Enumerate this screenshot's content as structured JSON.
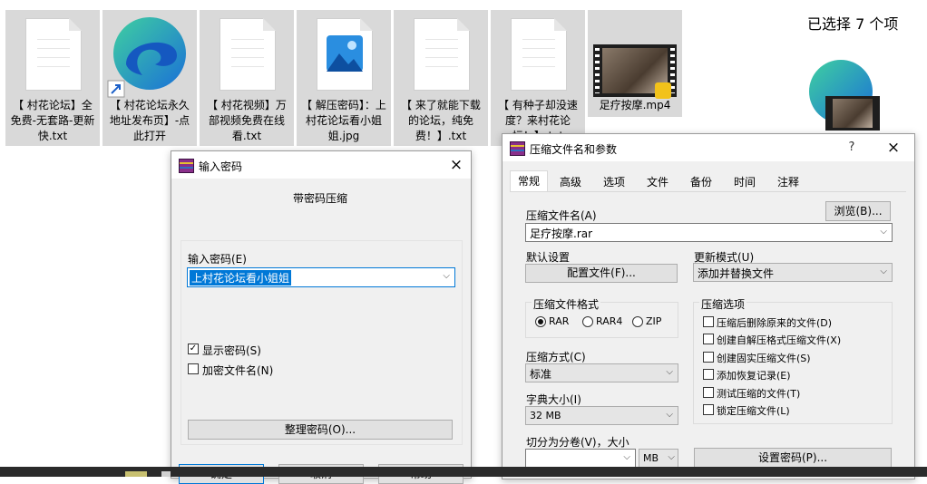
{
  "files": [
    {
      "name": "【 村花论坛】全免费-无套路-更新快.txt",
      "icon": "text-document-icon"
    },
    {
      "name": "【 村花论坛永久地址发布页】-点此打开",
      "icon": "edge-shortcut-icon"
    },
    {
      "name": "【 村花视频】万部视频免费在线看.txt",
      "icon": "text-document-icon"
    },
    {
      "name": "【 解压密码】：上村花论坛看小姐姐.jpg",
      "icon": "image-file-icon"
    },
    {
      "name": "【 来了就能下载的论坛，纯免费！】.txt",
      "icon": "text-document-icon"
    },
    {
      "name": "【 有种子却没速度？来村花论坛！】.txt",
      "icon": "text-document-icon"
    },
    {
      "name": "足疗按摩.mp4",
      "icon": "video-thumbnail-icon"
    }
  ],
  "selection_status": "已选择 7 个项",
  "password_dialog": {
    "title": "输入密码",
    "heading": "带密码压缩",
    "password_label": "输入密码(E)",
    "password_value": "上村花论坛看小姐姐",
    "show_password_label": "显示密码(S)",
    "show_password_checked": true,
    "encrypt_names_label": "加密文件名(N)",
    "encrypt_names_checked": false,
    "organize_button": "整理密码(O)...",
    "ok_button": "确定",
    "cancel_button": "取消",
    "help_button": "帮助"
  },
  "archive_dialog": {
    "title": "压缩文件名和参数",
    "help_glyph": "?",
    "tabs": [
      "常规",
      "高级",
      "选项",
      "文件",
      "备份",
      "时间",
      "注释"
    ],
    "active_tab": "常规",
    "archive_name_label": "压缩文件名(A)",
    "browse_button": "浏览(B)...",
    "archive_name_value": "足疗按摩.rar",
    "default_settings_label": "默认设置",
    "profiles_button": "配置文件(F)...",
    "update_mode_label": "更新模式(U)",
    "update_mode_value": "添加并替换文件",
    "format_label": "压缩文件格式",
    "formats": [
      {
        "label": "RAR",
        "selected": true
      },
      {
        "label": "RAR4",
        "selected": false
      },
      {
        "label": "ZIP",
        "selected": false
      }
    ],
    "options_label": "压缩选项",
    "options": [
      {
        "label": "压缩后删除原来的文件(D)",
        "checked": false
      },
      {
        "label": "创建自解压格式压缩文件(X)",
        "checked": false
      },
      {
        "label": "创建固实压缩文件(S)",
        "checked": false
      },
      {
        "label": "添加恢复记录(E)",
        "checked": false
      },
      {
        "label": "测试压缩的文件(T)",
        "checked": false
      },
      {
        "label": "锁定压缩文件(L)",
        "checked": false
      }
    ],
    "method_label": "压缩方式(C)",
    "method_value": "标准",
    "dict_label": "字典大小(I)",
    "dict_value": "32 MB",
    "split_label": "切分为分卷(V)，大小",
    "split_value": "",
    "split_unit": "MB",
    "set_password_button": "设置密码(P)..."
  }
}
